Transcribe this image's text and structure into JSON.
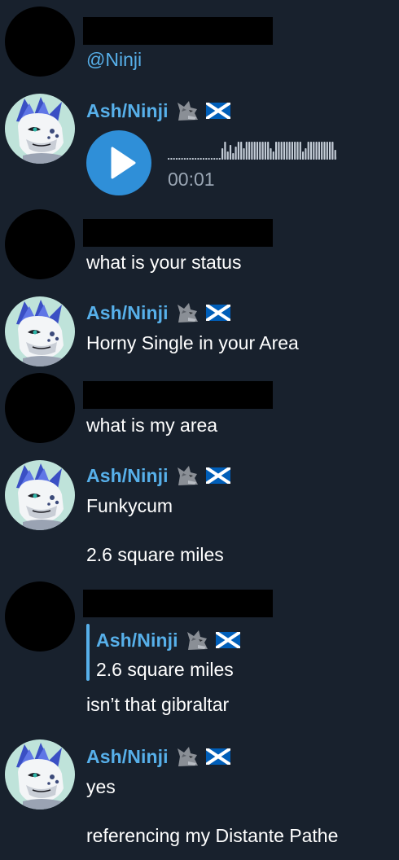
{
  "messages": {
    "m1": {
      "mention": "@Ninji"
    },
    "m2": {
      "name": "Ash/Ninji",
      "voice": {
        "duration": "00:01",
        "progress": 0
      }
    },
    "m3": {
      "text": "what is your status"
    },
    "m4": {
      "name": "Ash/Ninji",
      "text": "Horny Single in your Area"
    },
    "m5": {
      "text": "what is my area"
    },
    "m6": {
      "name": "Ash/Ninji",
      "text1": "Funkycum",
      "text2": "2.6 square miles"
    },
    "m7": {
      "reply": {
        "name": "Ash/Ninji",
        "text": "2.6 square miles"
      },
      "text": "isn’t that gibraltar"
    },
    "m8": {
      "name": "Ash/Ninji",
      "text1": "yes",
      "text2": "referencing my Distante Pathe"
    }
  },
  "icons": {
    "play": "play-icon",
    "wolf": "wolf-icon",
    "flag": "scotland-flag-icon"
  },
  "colors": {
    "background": "#18212d",
    "accent": "#57b0ea",
    "play_button": "#2f8fd8",
    "muted": "#9aa6b4",
    "text": "#ffffff"
  }
}
